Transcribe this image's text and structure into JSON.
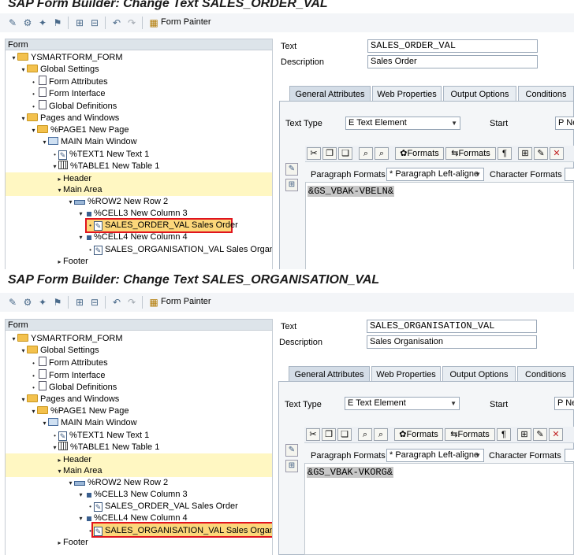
{
  "top": {
    "title": "SAP Form Builder: Change Text SALES_ORDER_VAL",
    "toolbar": {
      "form_painter_label": "Form Painter"
    },
    "tree": {
      "header": "Form",
      "nodes": {
        "root": "YSMARTFORM_FORM",
        "global": "Global Settings",
        "attrs": "Form Attributes",
        "iface": "Form Interface",
        "defs": "Global Definitions",
        "pages": "Pages and Windows",
        "page1": "%PAGE1 New Page",
        "main": "MAIN Main Window",
        "text1": "%TEXT1 New Text 1",
        "table1": "%TABLE1 New Table 1",
        "header": "Header",
        "mainarea": "Main Area",
        "row2": "%ROW2 New Row 2",
        "cell3": "%CELL3 New Column 3",
        "order": "SALES_ORDER_VAL Sales Order",
        "cell4": "%CELL4 New Column 4",
        "org": "SALES_ORGANISATION_VAL Sales Organisat",
        "footer": "Footer"
      }
    },
    "fields": {
      "text_label": "Text",
      "text_value": "SALES_ORDER_VAL",
      "desc_label": "Description",
      "desc_value": "Sales Order"
    },
    "tabs": [
      "General Attributes",
      "Web Properties",
      "Output Options",
      "Conditions"
    ],
    "text_type_label": "Text Type",
    "text_type_value": "E Text Element",
    "start_label": "Start",
    "start_value": "P Ne",
    "formats_label": "Formats",
    "para_formats_label": "Paragraph Formats",
    "para_formats_value": "* Paragraph Left-aligne",
    "char_formats_label": "Character Formats",
    "code": "&GS_VBAK-VBELN&"
  },
  "bottom": {
    "title": "SAP Form Builder: Change Text SALES_ORGANISATION_VAL",
    "toolbar": {
      "form_painter_label": "Form Painter"
    },
    "tree": {
      "header": "Form",
      "nodes": {
        "root": "YSMARTFORM_FORM",
        "global": "Global Settings",
        "attrs": "Form Attributes",
        "iface": "Form Interface",
        "defs": "Global Definitions",
        "pages": "Pages and Windows",
        "page1": "%PAGE1 New Page",
        "main": "MAIN Main Window",
        "text1": "%TEXT1 New Text 1",
        "table1": "%TABLE1 New Table 1",
        "header": "Header",
        "mainarea": "Main Area",
        "row2": "%ROW2 New Row 2",
        "cell3": "%CELL3 New Column 3",
        "order": "SALES_ORDER_VAL Sales Order",
        "cell4": "%CELL4 New Column 4",
        "org": "SALES_ORGANISATION_VAL Sales Organisat",
        "footer": "Footer"
      }
    },
    "fields": {
      "text_label": "Text",
      "text_value": "SALES_ORGANISATION_VAL",
      "desc_label": "Description",
      "desc_value": "Sales Organisation"
    },
    "tabs": [
      "General Attributes",
      "Web Properties",
      "Output Options",
      "Conditions"
    ],
    "text_type_label": "Text Type",
    "text_type_value": "E Text Element",
    "start_label": "Start",
    "start_value": "P Ne",
    "formats_label": "Formats",
    "para_formats_label": "Paragraph Formats",
    "para_formats_value": "* Paragraph Left-aligne",
    "char_formats_label": "Character Formats",
    "code": "&GS_VBAK-VKORG&"
  },
  "colors": {
    "highlight_border": "#e0141e",
    "selected_row": "#fcd77a",
    "band": "#fff7c2"
  },
  "icons": [
    "display-change-icon",
    "check-icon",
    "activate-icon",
    "test-icon",
    "field-list-icon",
    "form-painter-icon"
  ]
}
